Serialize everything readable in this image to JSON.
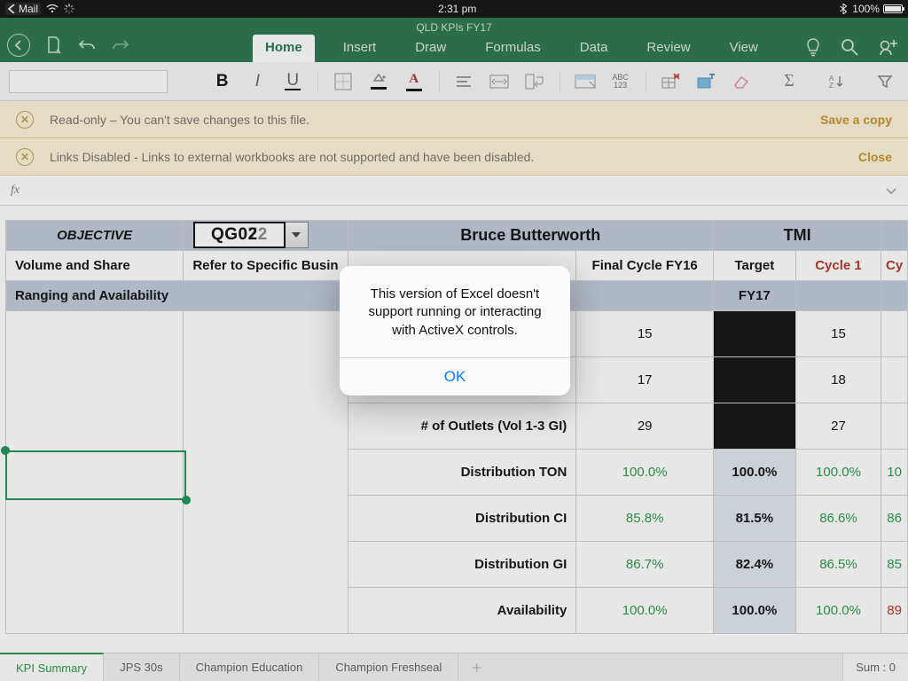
{
  "statusbar": {
    "back_label": "Mail",
    "time": "2:31 pm",
    "battery_pct": "100%"
  },
  "titlebar": {
    "doc_title": "QLD KPIs FY17",
    "tabs": [
      "Home",
      "Insert",
      "Draw",
      "Formulas",
      "Data",
      "Review",
      "View"
    ],
    "active_tab": 0
  },
  "info_bars": {
    "readonly": {
      "text": "Read-only – You can't save changes to this file.",
      "action": "Save a copy"
    },
    "links": {
      "text": "Links Disabled - Links to external workbooks are not supported and have been disabled.",
      "action": "Close"
    }
  },
  "activex_combo": {
    "display": "QG072",
    "overlay": "QG02"
  },
  "header_row1": {
    "objective": "OBJECTIVE",
    "owner": "Bruce Butterworth",
    "group": "TMI"
  },
  "header_row2": {
    "a": "Volume and Share",
    "b": "Refer to Specific Busin",
    "d": "Final Cycle FY16",
    "e": "Target",
    "f": "Cycle 1",
    "g": "Cy"
  },
  "section": {
    "label": "Ranging and Availability",
    "e": "FY17"
  },
  "rows": [
    {
      "label": "",
      "d": "15",
      "e": "",
      "f": "15",
      "g": "",
      "black": true
    },
    {
      "label": "",
      "d": "17",
      "e": "",
      "f": "18",
      "g": "",
      "black": true
    },
    {
      "label": "# of Outlets (Vol 1-3 GI)",
      "d": "29",
      "e": "",
      "f": "27",
      "g": "",
      "black": true
    },
    {
      "label": "Distribution TON",
      "d": "100.0%",
      "e": "100.0%",
      "f": "100.0%",
      "g": "10"
    },
    {
      "label": "Distribution CI",
      "d": "85.8%",
      "e": "81.5%",
      "f": "86.6%",
      "g": "86"
    },
    {
      "label": "Distribution GI",
      "d": "86.7%",
      "e": "82.4%",
      "f": "86.5%",
      "g": "85"
    },
    {
      "label": "Availability",
      "d": "100.0%",
      "e": "100.0%",
      "f": "100.0%",
      "g": "89",
      "g_red": true
    }
  ],
  "sheet_tabs": {
    "items": [
      "KPI Summary",
      "JPS 30s",
      "Champion Education",
      "Champion Freshseal"
    ],
    "active": 0
  },
  "status_sum": "Sum : 0",
  "alert": {
    "message": "This version of Excel doesn't support running or interacting with ActiveX controls.",
    "ok": "OK"
  }
}
